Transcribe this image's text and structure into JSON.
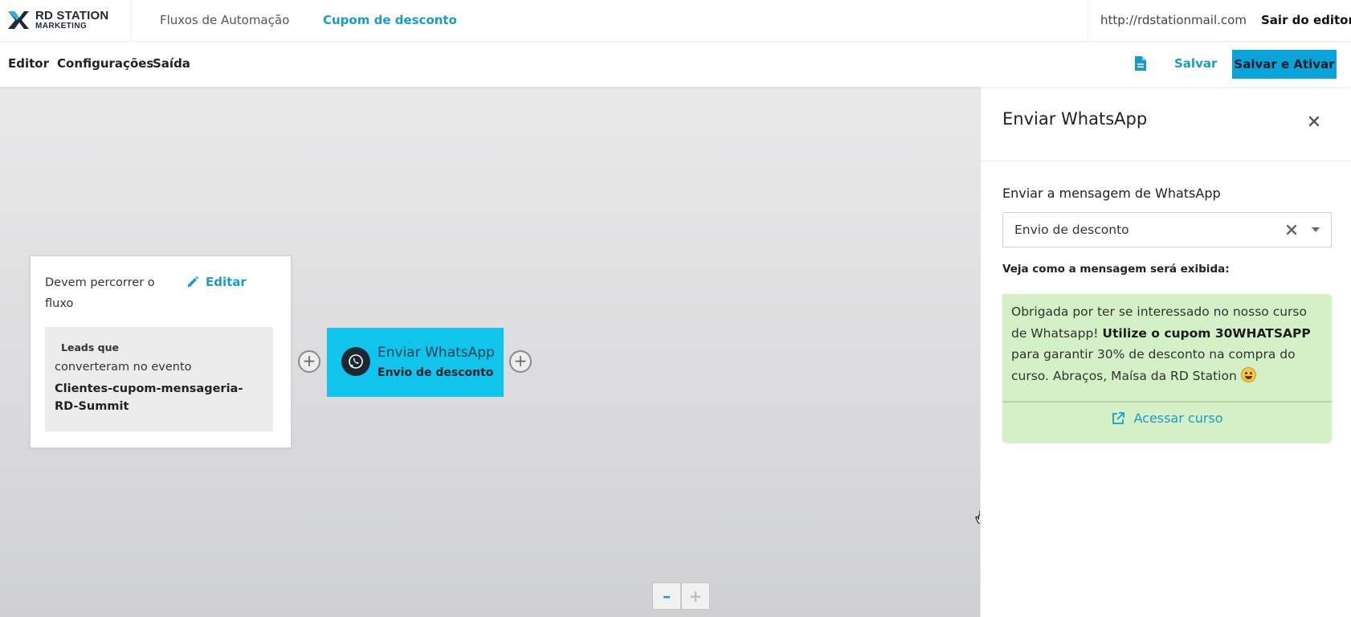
{
  "brand": {
    "line1": "RD STATION",
    "line2": "MARKETING"
  },
  "topnav": {
    "items": [
      {
        "label": "Fluxos de Automação"
      },
      {
        "label": "Cupom de desconto"
      }
    ],
    "url": "http://rdstationmail.com",
    "exit_label": "Sair do editor"
  },
  "subnav": {
    "items": [
      {
        "label": "Editor"
      },
      {
        "label": "Configurações"
      },
      {
        "label": "Saída"
      }
    ],
    "save_label": "Salvar",
    "save_activate_label": "Salvar e Ativar"
  },
  "canvas": {
    "trigger": {
      "title": "Devem percorrer o fluxo",
      "edit_label": "Editar",
      "leads_label": "Leads que",
      "leads_text": "converteram no evento",
      "event_name": "Clientes-cupom-mensageria-RD-Summit"
    },
    "node": {
      "title": "Enviar WhatsApp",
      "subtitle": "Envio de desconto"
    },
    "zoom": {
      "minus": "–",
      "plus": "+"
    }
  },
  "panel": {
    "title": "Enviar WhatsApp",
    "message_label": "Enviar a mensagem de WhatsApp",
    "selected_message": "Envio de desconto",
    "preview_label": "Veja como a mensagem será exibida:",
    "preview": {
      "text_part1": "Obrigada por ter se interessado no nosso curso de Whatsapp! ",
      "text_bold": "Utilize o cupom 30WHATSAPP",
      "text_part2": " para garantir 30% de desconto na compra do curso. Abraços, Maísa da RD Station ",
      "link_label": "Acessar curso"
    }
  },
  "colors": {
    "accent": "#1a9cc8",
    "primary_button": "#0aa4d8",
    "node": "#11c4ec",
    "preview_bg": "#d4f0c6"
  }
}
